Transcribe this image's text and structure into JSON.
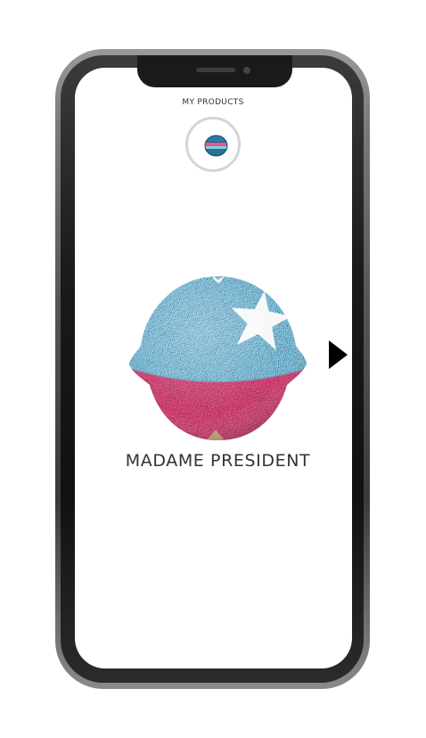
{
  "header": {
    "title": "MY PRODUCTS"
  },
  "product": {
    "name": "MADAME PRESIDENT"
  },
  "icons": {
    "thumbnail": "bath-bomb-thumbnail-icon",
    "next": "play-triangle-right-icon"
  },
  "colors": {
    "ball_top": "#87cfee",
    "ball_bottom": "#e84b82",
    "star": "#ffffff",
    "accent_tan": "#c9a27a",
    "arrow": "#000000"
  }
}
